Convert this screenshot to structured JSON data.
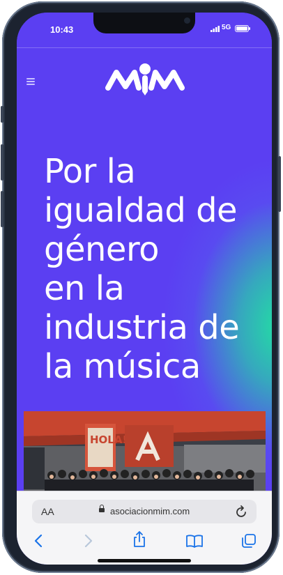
{
  "status_bar": {
    "time": "10:43",
    "network": "5G"
  },
  "site": {
    "logo_text": "MIM",
    "headline": "Por la\nigualdad de\ngénero\nen la\nindustria de\nla música",
    "photo_sign": "HOLA!"
  },
  "browser": {
    "text_size_label": "AA",
    "domain": "asociacionmim.com"
  },
  "colors": {
    "brand_purple": "#5b3ff2",
    "brand_green": "#22e0a2",
    "safari_blue": "#1a73e8"
  },
  "icons": [
    "menu-icon",
    "lock-icon",
    "reload-icon",
    "back-icon",
    "forward-icon",
    "share-icon",
    "bookmarks-icon",
    "tabs-icon"
  ]
}
